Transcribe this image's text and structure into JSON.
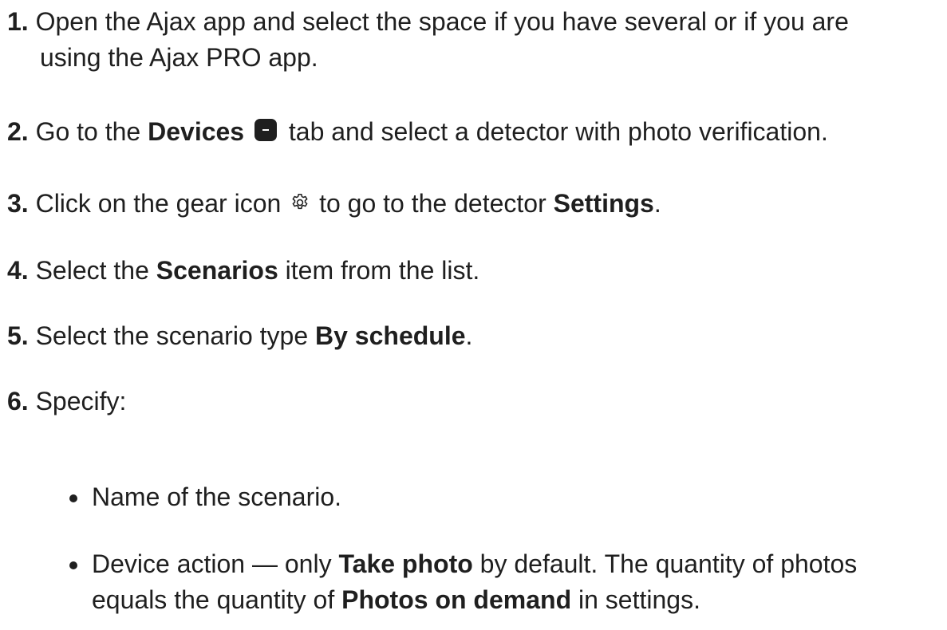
{
  "steps": [
    {
      "num": "1.",
      "line1": "Open the Ajax app and select the space if you have several or if you are",
      "line2": "using the Ajax PRO app."
    },
    {
      "num": "2.",
      "pre": "Go to the ",
      "bold": "Devices",
      "post": " tab and select a detector with photo verification.",
      "icon": "devices-tab-icon"
    },
    {
      "num": "3.",
      "pre": "Click on the gear icon ",
      "mid": " to go to the detector ",
      "bold": "Settings",
      "post": ".",
      "icon": "gear-icon"
    },
    {
      "num": "4.",
      "pre": "Select the ",
      "bold": "Scenarios",
      "post": " item from the list."
    },
    {
      "num": "5.",
      "pre": "Select the scenario type ",
      "bold": "By schedule",
      "post": "."
    },
    {
      "num": "6.",
      "text": "Specify:"
    }
  ],
  "bullets": [
    {
      "text": "Name of the scenario."
    },
    {
      "pre": "Device action — only ",
      "bold1": "Take photo",
      "mid": " by default. The quantity of photos",
      "line2_pre": "equals the quantity of ",
      "bold2": "Photos on demand",
      "line2_post": " in settings."
    }
  ]
}
